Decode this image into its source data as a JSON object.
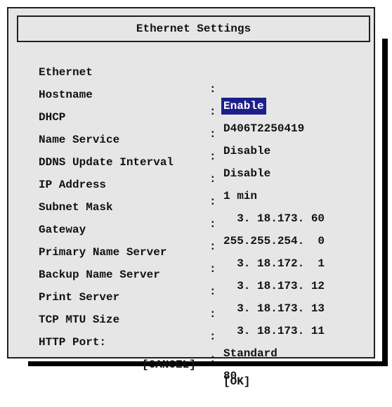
{
  "dialog": {
    "title": "Ethernet Settings",
    "colon": ":",
    "rows": [
      {
        "label": "Ethernet",
        "value": "Enable"
      },
      {
        "label": "Hostname",
        "value": "D406T2250419"
      },
      {
        "label": "DHCP",
        "value": "Disable"
      },
      {
        "label": "Name Service",
        "value": "Disable"
      },
      {
        "label": "DDNS Update Interval",
        "value": "1 min"
      },
      {
        "label": "IP Address",
        "value": "  3. 18.173. 60"
      },
      {
        "label": "Subnet Mask",
        "value": "255.255.254.  0"
      },
      {
        "label": "Gateway",
        "value": "  3. 18.172.  1"
      },
      {
        "label": "Primary Name Server",
        "value": "  3. 18.173. 12"
      },
      {
        "label": "Backup Name Server",
        "value": "  3. 18.173. 13"
      },
      {
        "label": "Print Server",
        "value": "  3. 18.173. 11"
      },
      {
        "label": "TCP MTU Size",
        "value": "Standard"
      },
      {
        "label": "HTTP Port:",
        "value": "80"
      }
    ],
    "cancel_label": "[CANCEL]",
    "ok_label": "[OK]",
    "highlight_color": "#1e1e8a"
  }
}
